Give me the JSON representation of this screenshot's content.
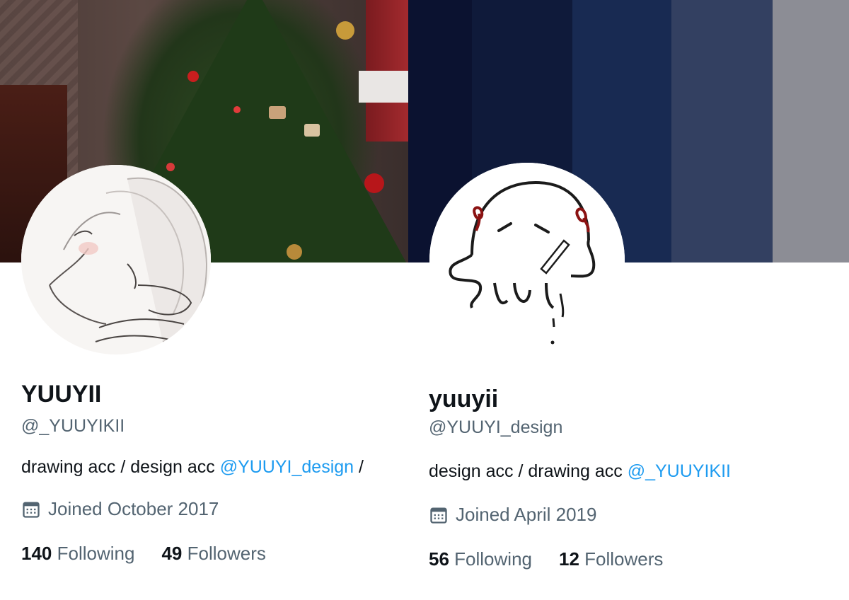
{
  "profiles": [
    {
      "display_name": "YUUYII",
      "handle": "@_YUUYIKII",
      "bio_text": "drawing acc / design acc ",
      "bio_mention": "@YUUYI_design",
      "bio_tail": " / ",
      "joined": "Joined October 2017",
      "following_count": "140",
      "following_label": "Following",
      "followers_count": "49",
      "followers_label": "Followers",
      "banner": "christmas-tree-photo",
      "avatar": "sketch-portrait-avatar"
    },
    {
      "display_name": "yuuyii",
      "handle": "@YUUYI_design",
      "bio_text": "design acc / drawing acc ",
      "bio_mention": "@_YUUYIKII",
      "joined": "Joined April 2019",
      "following_count": "56",
      "following_label": "Following",
      "followers_count": "12",
      "followers_label": "Followers",
      "banner": "navy-gradient-stripes",
      "banner_colors": [
        "#0b1230",
        "#0f1a3a",
        "#182a52",
        "#334061",
        "#8c8d95"
      ],
      "avatar": "ghost-doodle-avatar"
    }
  ],
  "colors": {
    "text": "#0f1419",
    "secondary": "#536471",
    "link": "#1d9bf0"
  }
}
